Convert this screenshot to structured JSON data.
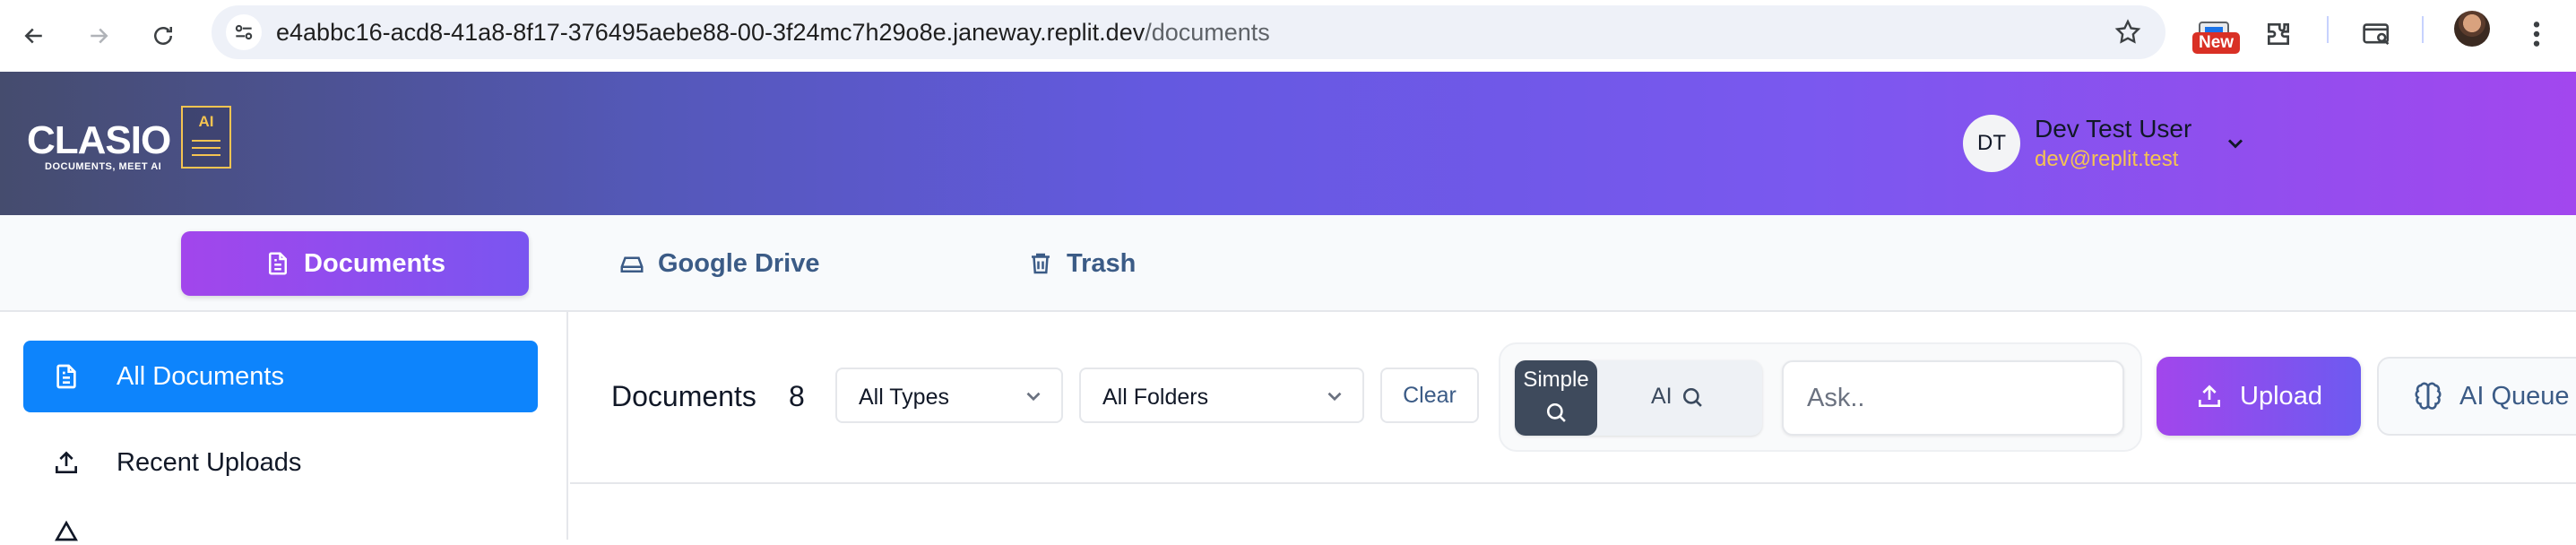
{
  "browser": {
    "url_host": "e4abbc16-acd8-41a8-8f17-376495aebe88-00-3f24mc7h29o8e.janeway.replit.dev",
    "url_path": "/documents",
    "new_badge": "New",
    "icons": [
      "back-icon",
      "forward-icon",
      "reload-icon",
      "site-info-icon",
      "bookmark-star-icon",
      "extension-icon",
      "puzzle-icon",
      "tab-search-icon",
      "profile-avatar",
      "more-icon"
    ]
  },
  "header": {
    "logo_word": "CLASIO",
    "logo_badge": "AI",
    "logo_tagline": "DOCUMENTS, MEET AI",
    "user": {
      "initials": "DT",
      "name": "Dev Test User",
      "email": "dev@replit.test"
    }
  },
  "tabs": [
    {
      "label": "Documents",
      "icon": "document-icon",
      "active": true
    },
    {
      "label": "Google Drive",
      "icon": "drive-icon",
      "active": false
    },
    {
      "label": "Trash",
      "icon": "trash-icon",
      "active": false
    }
  ],
  "sidebar": {
    "items": [
      {
        "label": "All Documents",
        "icon": "document-icon",
        "active": true
      },
      {
        "label": "Recent Uploads",
        "icon": "upload-icon",
        "active": false
      }
    ]
  },
  "toolbar": {
    "title": "Documents",
    "count": "8",
    "type_filter": "All Types",
    "folder_filter": "All Folders",
    "clear_label": "Clear",
    "mode_simple": "Simple",
    "mode_ai": "AI",
    "search_placeholder": "Ask..",
    "upload_label": "Upload",
    "queue_label": "AI Queue"
  },
  "colors": {
    "accent_purple": "#a246ec",
    "sidebar_active": "#0d84fc",
    "email_gold": "#f5c451",
    "header_gradient_start": "#454c6e",
    "header_gradient_end": "#a247ee"
  }
}
